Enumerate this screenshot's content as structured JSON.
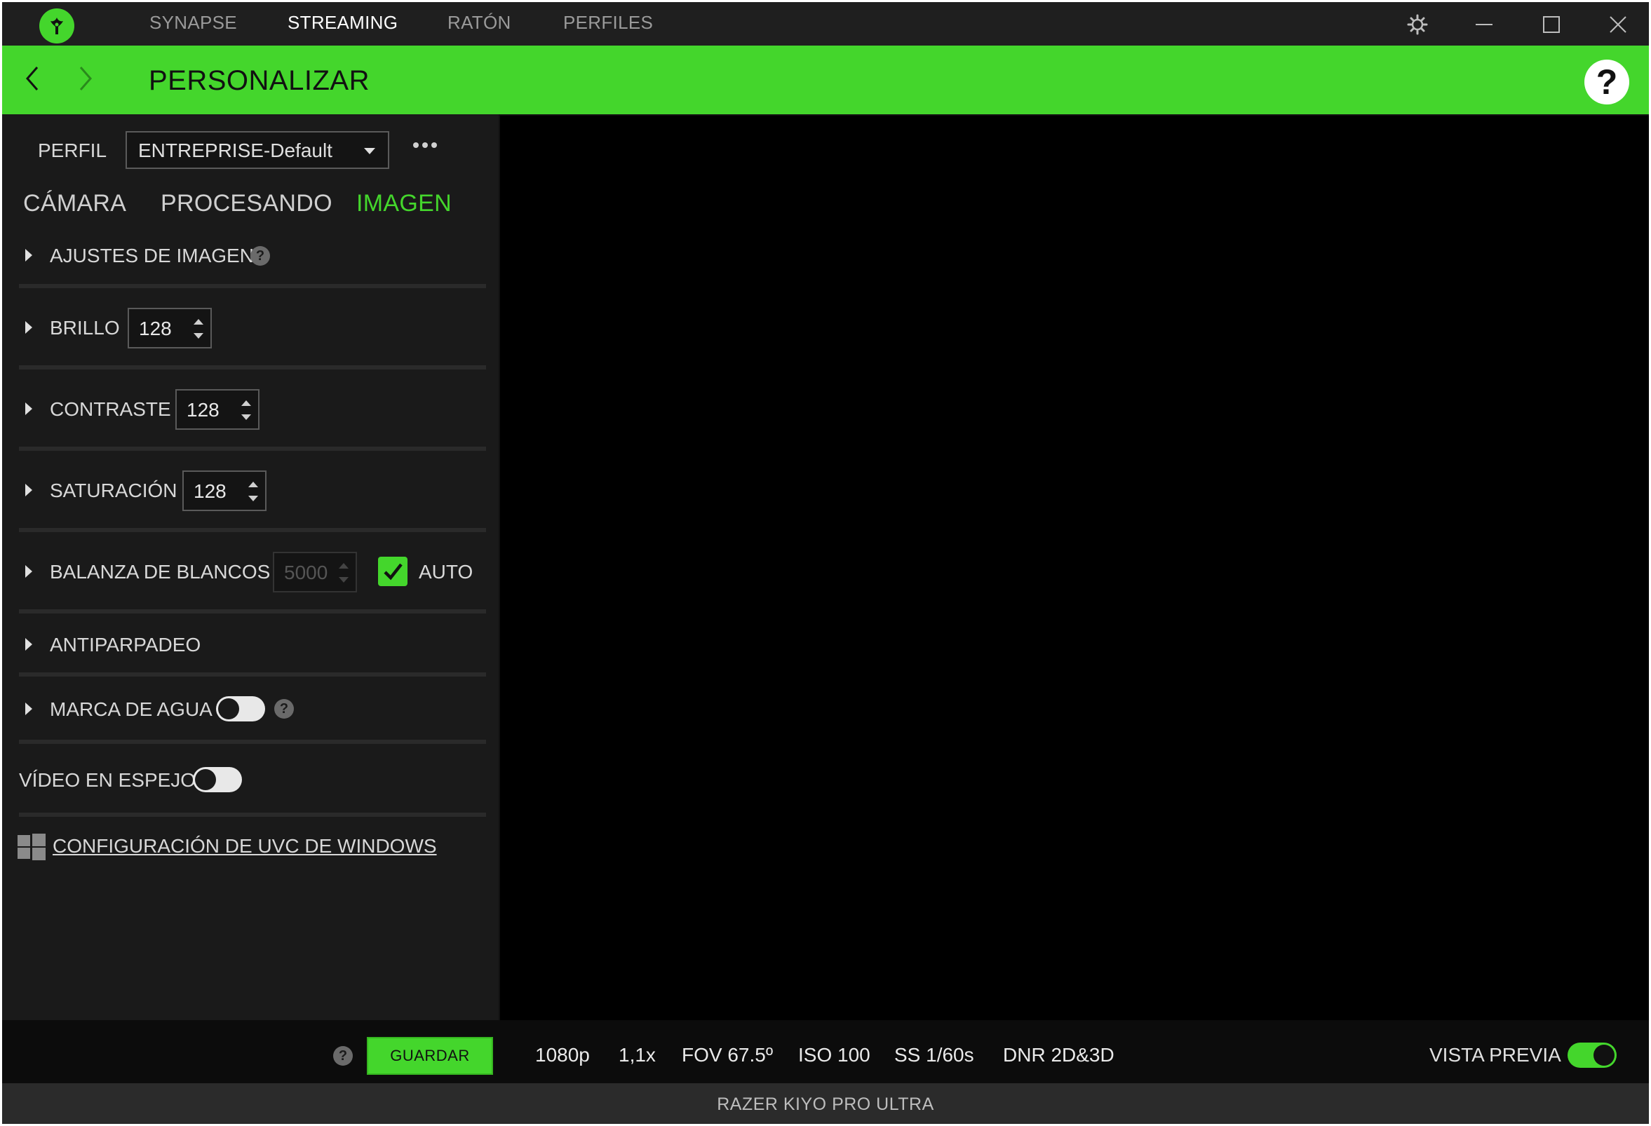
{
  "titlebar": {
    "tabs": [
      {
        "label": "SYNAPSE",
        "active": false
      },
      {
        "label": "STREAMING",
        "active": true
      },
      {
        "label": "RATÓN",
        "active": false
      },
      {
        "label": "PERFILES",
        "active": false
      }
    ],
    "icons": [
      "razer-logo-icon",
      "settings-icon",
      "minimize-icon",
      "maximize-icon",
      "close-icon"
    ]
  },
  "header": {
    "title": "PERSONALIZAR",
    "help": "?"
  },
  "profile": {
    "label": "PERFIL",
    "value": "ENTREPRISE-Default"
  },
  "subtabs": [
    {
      "label": "CÁMARA",
      "active": false
    },
    {
      "label": "PROCESANDO",
      "active": false
    },
    {
      "label": "IMAGEN",
      "active": true
    }
  ],
  "settings": {
    "image_adjust": {
      "label": "AJUSTES DE IMAGEN"
    },
    "brightness": {
      "label": "BRILLO",
      "value": "128"
    },
    "contrast": {
      "label": "CONTRASTE",
      "value": "128"
    },
    "saturation": {
      "label": "SATURACIÓN",
      "value": "128"
    },
    "white_balance": {
      "label": "BALANZA DE BLANCOS",
      "value": "5000",
      "auto_label": "AUTO",
      "auto_checked": true
    },
    "antiflicker": {
      "label": "ANTIPARPADEO"
    },
    "watermark": {
      "label": "MARCA DE AGUA",
      "enabled": false
    },
    "mirror": {
      "label": "VÍDEO EN ESPEJO",
      "enabled": false
    },
    "uvc_link": "CONFIGURACIÓN DE UVC DE WINDOWS"
  },
  "bottom": {
    "save_label": "GUARDAR",
    "stats": [
      "1080p",
      "1,1x",
      "FOV 67.5º",
      "ISO 100",
      "SS 1/60s",
      "DNR 2D&3D"
    ],
    "preview_label": "VISTA PREVIA",
    "preview_enabled": true
  },
  "status": {
    "device": "RAZER KIYO PRO ULTRA"
  },
  "colors": {
    "accent": "#44d62c",
    "panel": "#1a1a1a",
    "titlebar": "#1f1f1f",
    "preview": "#000000"
  }
}
